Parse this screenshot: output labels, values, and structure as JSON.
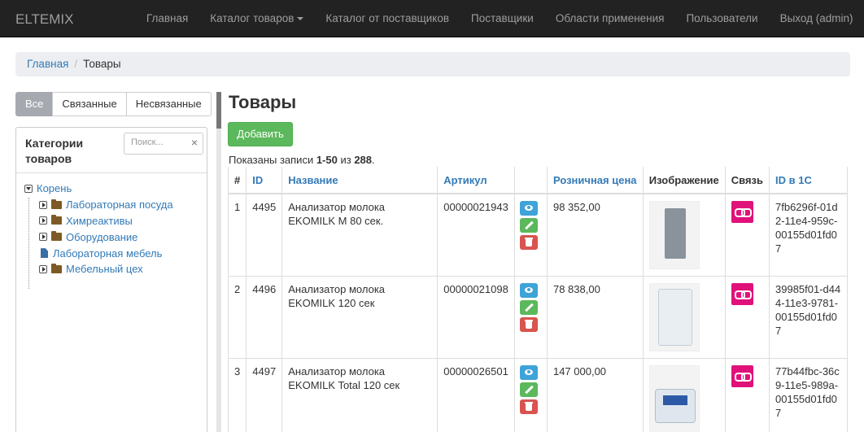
{
  "nav": {
    "brand": "ELTEMIX",
    "items": [
      "Главная",
      "Каталог товаров",
      "Каталог от поставщиков",
      "Поставщики",
      "Области применения",
      "Пользователи",
      "Выход (admin)"
    ]
  },
  "breadcrumb": {
    "home": "Главная",
    "separator": "/",
    "current": "Товары"
  },
  "filter": {
    "all": "Все",
    "linked": "Связанные",
    "unlinked": "Несвязанные"
  },
  "categories": {
    "title": "Категории товаров",
    "search_placeholder": "Поиск...",
    "clear": "×",
    "root": "Корень",
    "items": [
      "Лабораторная посуда",
      "Химреактивы",
      "Оборудование",
      "Лабораторная мебель",
      "Мебельный цех"
    ]
  },
  "main": {
    "title": "Товары",
    "add_label": "Добавить",
    "summary_prefix": "Показаны записи ",
    "summary_range": "1-50",
    "summary_mid": " из ",
    "summary_total": "288",
    "summary_suffix": "."
  },
  "table": {
    "headers": [
      "#",
      "ID",
      "Название",
      "Артикул",
      "",
      "Розничная цена",
      "Изображение",
      "Связь",
      "ID в 1С"
    ],
    "rows": [
      {
        "num": "1",
        "id": "4495",
        "name": "Анализатор молока EKOMILK M 80 сек.",
        "sku": "00000021943",
        "price": "98 352,00",
        "id1c": "7fb6296f-01d2-11e4-959c-00155d01fd07"
      },
      {
        "num": "2",
        "id": "4496",
        "name": "Анализатор молока EKOMILK 120 сек",
        "sku": "00000021098",
        "price": "78 838,00",
        "id1c": "39985f01-d444-11e3-9781-00155d01fd07"
      },
      {
        "num": "3",
        "id": "4497",
        "name": "Анализатор молока EKOMILK Total 120 сек",
        "sku": "00000026501",
        "price": "147 000,00",
        "id1c": "77b44fbc-36c9-11e5-989a-00155d01fd07"
      }
    ]
  },
  "colors": {
    "navbar": "#222222",
    "link": "#337ab7",
    "success": "#5cb85c",
    "danger": "#d9534f",
    "info": "#3ea3d8",
    "link_badge": "#e0127a"
  }
}
